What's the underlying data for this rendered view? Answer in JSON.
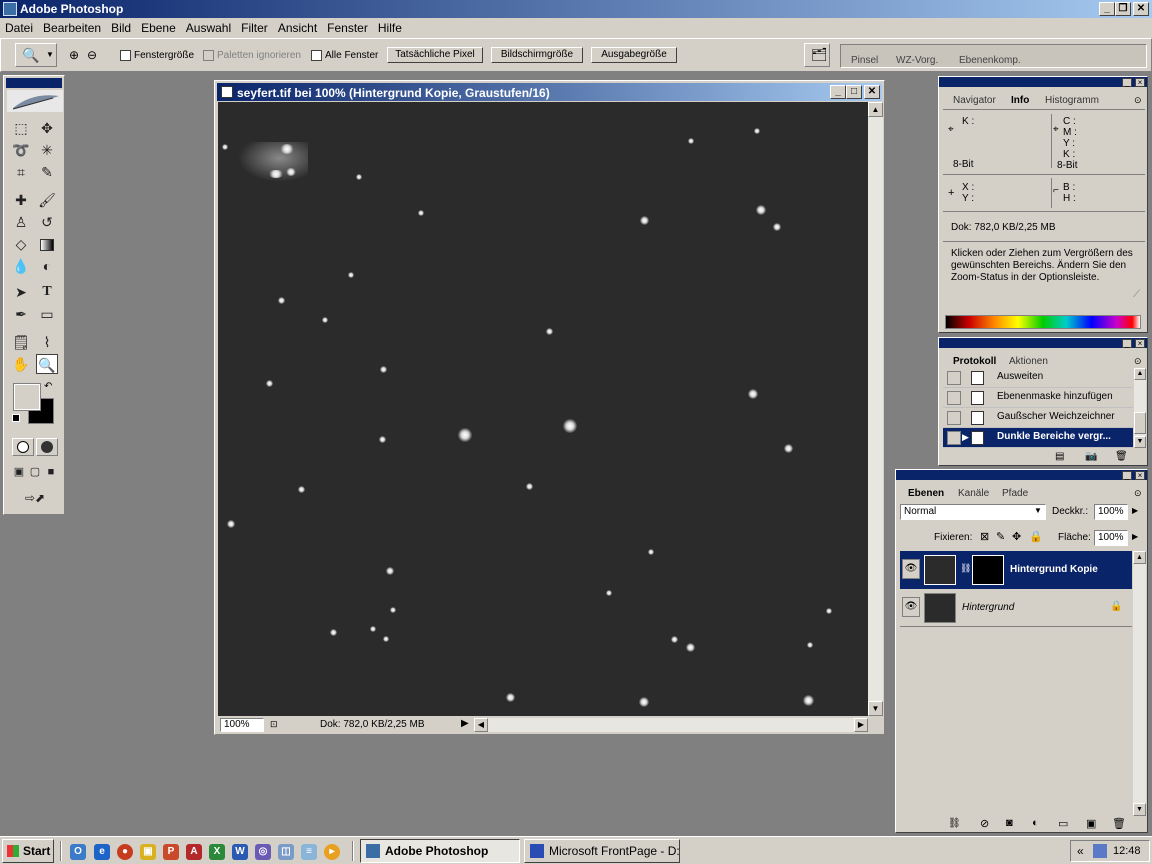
{
  "app": {
    "title": "Adobe Photoshop"
  },
  "menu": [
    "Datei",
    "Bearbeiten",
    "Bild",
    "Ebene",
    "Auswahl",
    "Filter",
    "Ansicht",
    "Fenster",
    "Hilfe"
  ],
  "options_bar": {
    "fenstergroesse": "Fenstergröße",
    "paletten_ignorieren": "Paletten ignorieren",
    "alle_fenster": "Alle Fenster",
    "tatsaechliche_pixel": "Tatsächliche Pixel",
    "bildschirmgroesse": "Bildschirmgröße",
    "ausgabegroesse": "Ausgabegröße",
    "well_tabs": [
      "Pinsel",
      "WZ-Vorg.",
      "Ebenenkomp."
    ]
  },
  "document": {
    "title": "seyfert.tif bei 100% (Hintergrund Kopie, Graustufen/16)",
    "zoom": "100%",
    "doc_info": "Dok: 782,0 KB/2,25 MB"
  },
  "info_panel": {
    "tabs": [
      "Navigator",
      "Info",
      "Histogramm"
    ],
    "active_tab": "Info",
    "k_label": "K :",
    "bit_left": "8-Bit",
    "c_label": "C :",
    "m_label": "M :",
    "y_label": "Y :",
    "k2_label": "K :",
    "bit_right": "8-Bit",
    "x_label": "X :",
    "y2_label": "Y :",
    "b_label": "B :",
    "h_label": "H :",
    "doc": "Dok: 782,0 KB/2,25 MB",
    "help": "Klicken oder Ziehen zum Vergrößern des gewünschten Bereichs. Ändern Sie den Zoom-Status in der Optionsleiste."
  },
  "history_panel": {
    "tabs": [
      "Protokoll",
      "Aktionen"
    ],
    "items": [
      "Ausweiten",
      "Ebenenmaske hinzufügen",
      "Gaußscher Weichzeichner",
      "Dunkle Bereiche vergr..."
    ],
    "selected_index": 3
  },
  "layers_panel": {
    "tabs": [
      "Ebenen",
      "Kanäle",
      "Pfade"
    ],
    "blend_mode": "Normal",
    "opacity_label": "Deckkr.:",
    "opacity": "100%",
    "lock_label": "Fixieren:",
    "fill_label": "Fläche:",
    "fill": "100%",
    "layers": [
      "Hintergrund Kopie",
      "Hintergrund"
    ],
    "selected_index": 0
  },
  "taskbar": {
    "start": "Start",
    "tasks": [
      "Adobe Photoshop",
      "Microsoft FrontPage - D:..."
    ],
    "time": "12:48",
    "tray_chevron": "«"
  },
  "colors": {
    "title_active": "#0a246a",
    "chrome": "#d4d0c8",
    "workspace": "#808080",
    "image_bg": "#2b2b2b"
  }
}
